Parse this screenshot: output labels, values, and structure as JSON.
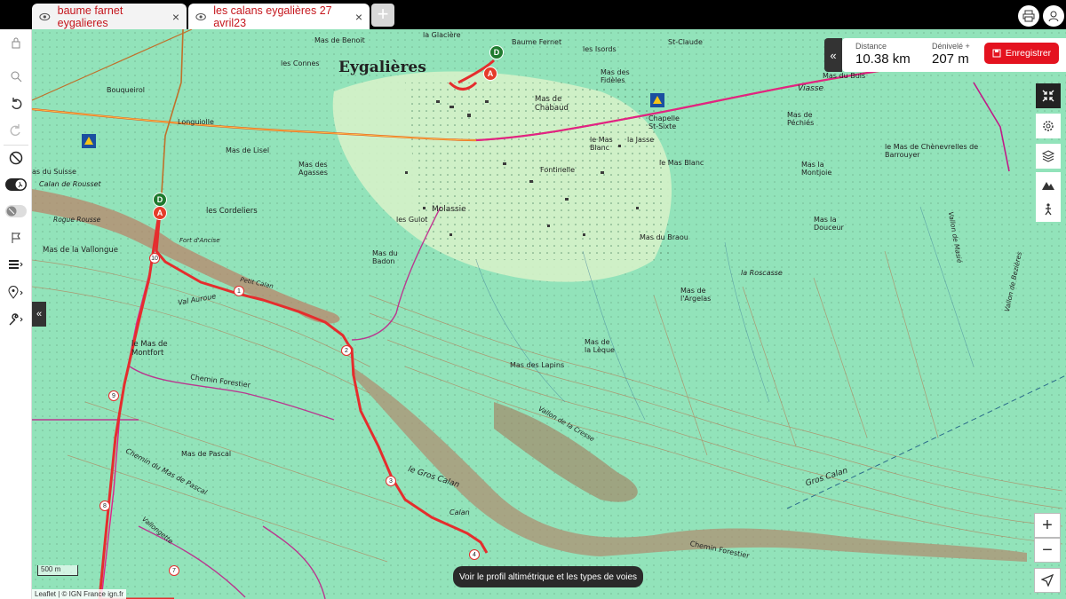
{
  "tabs": [
    {
      "label": "baume farnet eygalieres",
      "close": "×"
    },
    {
      "label": "les calans eygalières 27 avril23",
      "close": "×"
    }
  ],
  "new_tab": "+",
  "stats": {
    "distance_label": "Distance",
    "distance_value": "10.38 km",
    "elevation_label": "Dénivelé +",
    "elevation_value": "207 m",
    "save_label": "Enregistrer"
  },
  "map": {
    "labels": {
      "town": "Eygalières",
      "baume_fernet": "Baume Fernet",
      "la_glaciere": "la Glacière",
      "st_claude": "St-Claude",
      "mas_de_benoit": "Mas de Benoit",
      "les_connes": "les Connes",
      "bouqueirol": "Bouqueirol",
      "longuiolle": "Longuiolle",
      "mas_de_lisel": "Mas de Lisel",
      "mas_des_agasses": "Mas des Agasses",
      "mas_de_chabaud": "Mas de Chabaud",
      "les_isords": "les Isords",
      "mas_des_fideles": "Mas des Fidèles",
      "chapelle": "Chapelle St-Sixte",
      "le_mas_blanc": "le Mas Blanc",
      "la_jasse": "la Jasse",
      "le_mas_blanc2": "le Mas Blanc",
      "mas_de_pechies": "Mas de Péchiés",
      "mas_la_montjoie": "Mas la Montjoie",
      "le_mas_chenevrelles": "le Mas de Chènevrelles de Barrouyer",
      "viasse": "Viasse",
      "mas_du_buis": "Mas du Buis",
      "mas_du_suisse": "as du Suisse",
      "calan_de_rousset": "Calan de Rousset",
      "rogue_rousse": "Rogue Rousse",
      "les_cordeliers": "les Cordeliers",
      "fontinelle": "Fontinelle",
      "les_guiot": "les Guiot",
      "molassie": "Molassie",
      "mas_du_badon": "Mas du Badon",
      "mas_de_la_vallongue": "Mas de la Vallongue",
      "fort_ancise": "Fort d'Ancise",
      "petit_calan": "Petit Calan",
      "val_auroue": "Val Auroue",
      "mas_du_braou": "Mas du Braou",
      "mas_la_douceur": "Mas la Douceur",
      "la_roscasse": "la Roscasse",
      "mas_de_largelas": "Mas de l'Argelas",
      "le_mas_de_montfort": "le Mas de Montfort",
      "chemin_forestier": "Chemin Forestier",
      "mas_des_lapins": "Mas des Lapins",
      "mas_de_la_leque": "Mas de la Lèque",
      "vallon_de_la_cresse": "Vallon de la Cresse",
      "le_gros_calan": "le Gros Calan",
      "calan": "Calan",
      "mas_de_pascal": "Mas de Pascal",
      "chemin_du_mas_de_pascal": "Chemin du Mas de Pascal",
      "vallongette": "Vallongette",
      "gros_calan": "Gros Calan",
      "chemin_forestier2": "Chemin Forestier",
      "vallon_de_bezieres": "Vallon de Bezières",
      "vallon_mansier": "Vallon de Masié"
    },
    "route_markers": {
      "start": "D",
      "end": "A"
    },
    "km_markers": [
      "1",
      "2",
      "3",
      "4",
      "7",
      "8",
      "9",
      "10"
    ]
  },
  "tools_right": [
    "collapse-icon",
    "settings-icon",
    "layers-icon",
    "hiker-icon",
    "pin-icon"
  ],
  "zoom": {
    "in": "+",
    "out": "−"
  },
  "profile_button": "Voir le profil altimétrique et les types de voies",
  "scale_label": "500 m",
  "attribution": "Leaflet | © IGN France ign.fr",
  "colors": {
    "accent": "#e4121f",
    "route": "#e52d2d",
    "map_green": "#8fe0b8"
  }
}
